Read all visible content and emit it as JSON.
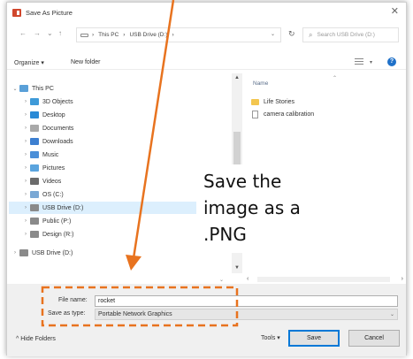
{
  "window": {
    "title": "Save As Picture",
    "close_glyph": "✕"
  },
  "address": {
    "back_glyph": "←",
    "forward_glyph": "→",
    "recent_glyph": "⌄",
    "up_glyph": "↑",
    "path": [
      "This PC",
      "›",
      "USB Drive (D:)",
      "›"
    ],
    "refresh_glyph": "↻",
    "search_placeholder": "Search USB Drive (D:)"
  },
  "toolbar": {
    "organize_label": "Organize ▾",
    "new_folder_label": "New folder",
    "view_icon": "view-options-icon",
    "help_label": "?"
  },
  "nav": {
    "items": [
      {
        "label": "This PC",
        "expander": "⌄",
        "icon": "computer-icon",
        "color": "#5aa0d8"
      },
      {
        "label": "3D Objects",
        "expander": "›",
        "icon": "cube-icon",
        "color": "#3e9ad8"
      },
      {
        "label": "Desktop",
        "expander": "›",
        "icon": "desktop-icon",
        "color": "#2a8ad6"
      },
      {
        "label": "Documents",
        "expander": "›",
        "icon": "document-icon",
        "color": "#a9a9a9"
      },
      {
        "label": "Downloads",
        "expander": "›",
        "icon": "download-icon",
        "color": "#3d7fd0"
      },
      {
        "label": "Music",
        "expander": "›",
        "icon": "music-icon",
        "color": "#4b8fd8"
      },
      {
        "label": "Pictures",
        "expander": "›",
        "icon": "pictures-icon",
        "color": "#5aa4de"
      },
      {
        "label": "Videos",
        "expander": "›",
        "icon": "video-icon",
        "color": "#6b6b6b"
      },
      {
        "label": "OS (C:)",
        "expander": "›",
        "icon": "drive-icon",
        "color": "#7aa8d4"
      },
      {
        "label": "USB Drive (D:)",
        "expander": "›",
        "icon": "usb-drive-icon",
        "color": "#8a8a8a"
      },
      {
        "label": "Public (P:)",
        "expander": "›",
        "icon": "network-drive-icon",
        "color": "#8a8a8a"
      },
      {
        "label": "Design (R:)",
        "expander": "›",
        "icon": "network-drive-icon",
        "color": "#8a8a8a"
      },
      {
        "label": "USB Drive (D:)",
        "expander": "›",
        "icon": "usb-drive-icon",
        "color": "#8a8a8a"
      }
    ],
    "selected_index": 9
  },
  "files": {
    "column_name": "Name",
    "sort_glyph": "⌃",
    "items": [
      {
        "label": "Life Stories",
        "type": "folder"
      },
      {
        "label": "camera calibration",
        "type": "file"
      }
    ]
  },
  "save": {
    "filename_label": "File name:",
    "filename_value": "rocket",
    "type_label": "Save as type:",
    "type_value": "Portable Network Graphics",
    "dropdown_glyph": "⌄"
  },
  "footer": {
    "hide_folders_label": "^ Hide Folders",
    "tools_label": "Tools  ▾",
    "save_label": "Save",
    "cancel_label": "Cancel"
  },
  "annotation": {
    "text": "Save the\nimage as a\n.PNG",
    "color": "#e8731f"
  }
}
